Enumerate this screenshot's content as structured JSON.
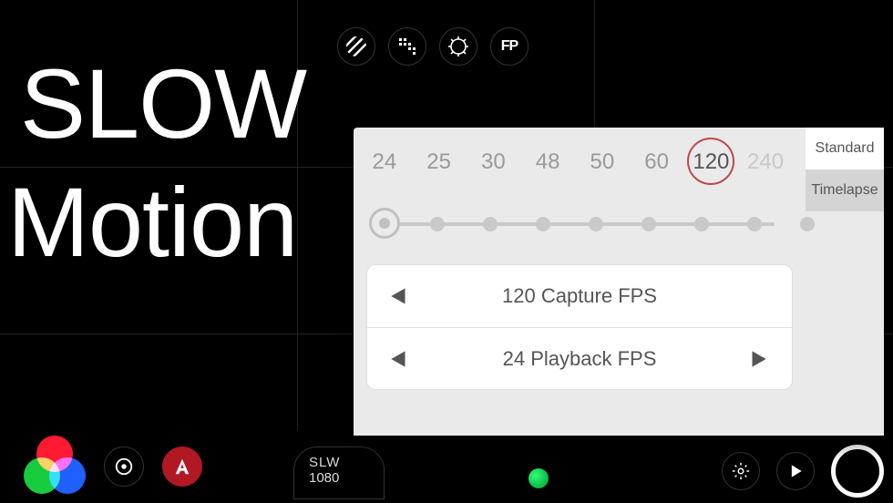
{
  "overlay_title": {
    "line1": "SLOW",
    "line2": "Motion"
  },
  "toolbar": {
    "fp": "FP"
  },
  "bottom": {
    "mode_label": "SLW",
    "resolution": "1080"
  },
  "panel": {
    "fps_options": [
      {
        "value": 24,
        "selected": false,
        "disabled": false
      },
      {
        "value": 25,
        "selected": false,
        "disabled": false
      },
      {
        "value": 30,
        "selected": false,
        "disabled": false
      },
      {
        "value": 48,
        "selected": false,
        "disabled": false
      },
      {
        "value": 50,
        "selected": false,
        "disabled": false
      },
      {
        "value": 60,
        "selected": false,
        "disabled": false
      },
      {
        "value": 120,
        "selected": true,
        "disabled": false
      },
      {
        "value": 240,
        "selected": false,
        "disabled": true
      }
    ],
    "slider": {
      "stops": 9,
      "handle_index": 0
    },
    "capture_label": "120 Capture FPS",
    "playback_label": "24 Playback FPS",
    "tabs": [
      "Standard",
      "Timelapse"
    ],
    "active_tab": 0
  }
}
